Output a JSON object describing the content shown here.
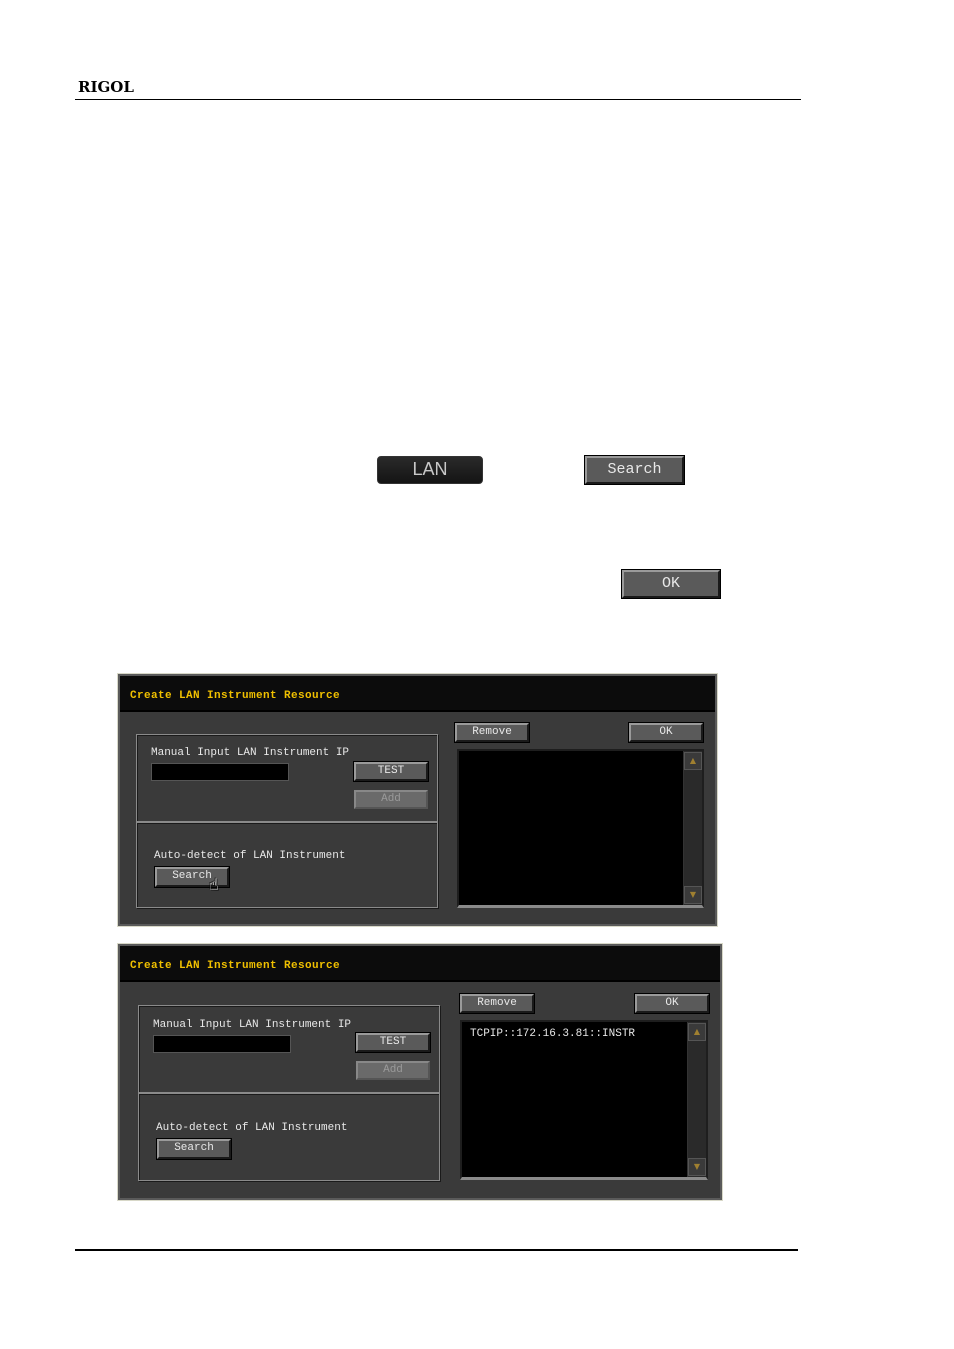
{
  "header": {
    "brand": "RIGOL"
  },
  "inline_keys": {
    "lan": "LAN",
    "search": "Search",
    "ok": "OK"
  },
  "dialogs": [
    {
      "title": "Create LAN Instrument Resource",
      "manual_label": "Manual Input LAN Instrument IP",
      "ip_value": "",
      "test_label": "TEST",
      "add_label": "Add",
      "auto_label": "Auto-detect of LAN Instrument",
      "search_label": "Search",
      "remove_label": "Remove",
      "ok_label": "OK",
      "resources": [],
      "cursor_icon": "hand-pointer"
    },
    {
      "title": "Create LAN Instrument Resource",
      "manual_label": "Manual Input LAN Instrument IP",
      "ip_value": "",
      "test_label": "TEST",
      "add_label": "Add",
      "auto_label": "Auto-detect of LAN Instrument",
      "search_label": "Search",
      "remove_label": "Remove",
      "ok_label": "OK",
      "resources": [
        "TCPIP::172.16.3.81::INSTR"
      ]
    }
  ],
  "icons": {
    "scroll_up": "▲",
    "scroll_down": "▼",
    "hand": "☝"
  },
  "colors": {
    "title_text": "#f0c000",
    "dialog_bg": "#3a3a3a",
    "list_bg": "#000000"
  }
}
